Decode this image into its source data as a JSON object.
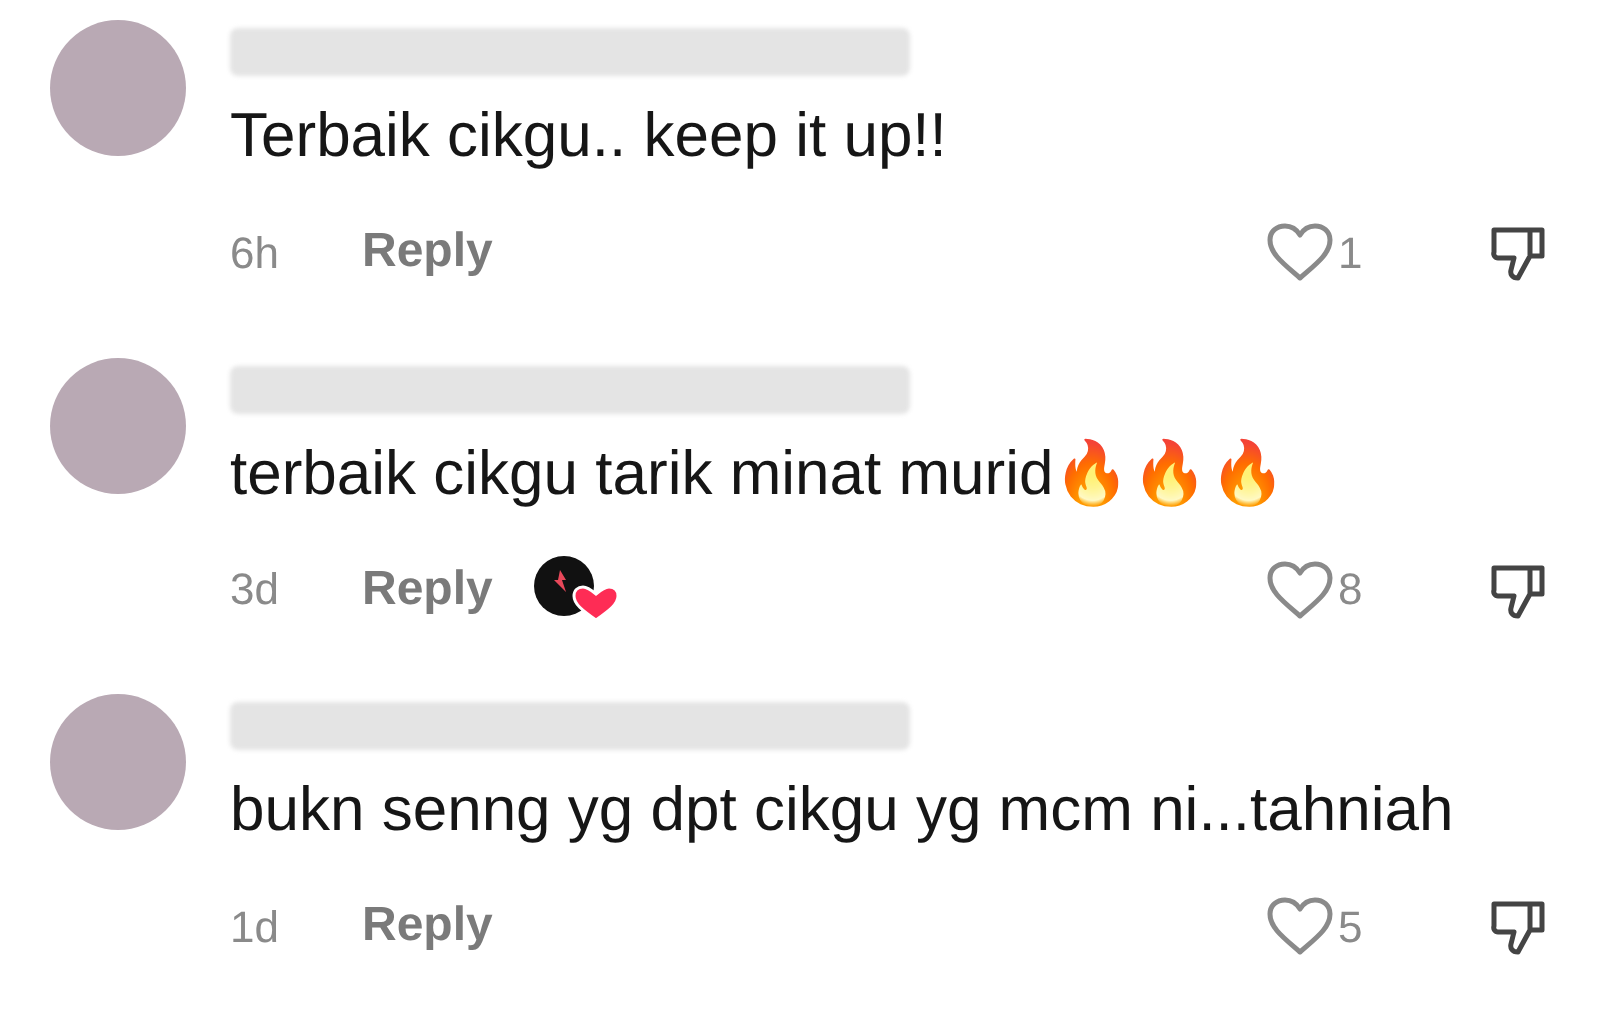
{
  "comments": [
    {
      "text": "Terbaik cikgu.. keep it up!!",
      "time": "6h",
      "reply": "Reply",
      "likes": "1",
      "liked_by_creator": false
    },
    {
      "text": "terbaik cikgu tarik minat murid🔥🔥🔥",
      "time": "3d",
      "reply": "Reply",
      "likes": "8",
      "liked_by_creator": true
    },
    {
      "text": "bukn senng yg dpt cikgu yg mcm ni...tahniah",
      "time": "1d",
      "reply": "Reply",
      "likes": "5",
      "liked_by_creator": false
    }
  ]
}
